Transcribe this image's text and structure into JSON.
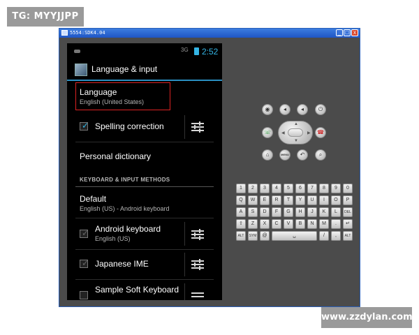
{
  "overlays": {
    "top_left_tag": "TG: MYYJJPP",
    "bottom_right_tag": "www.zzdylan.com"
  },
  "window": {
    "title": "5554:SDK4.04",
    "buttons": [
      "_",
      "□",
      "x"
    ]
  },
  "phone": {
    "status": {
      "signal": "3G",
      "time": "2:52"
    },
    "action_bar": {
      "title": "Language & input"
    },
    "items": {
      "language": {
        "title": "Language",
        "subtitle": "English (United States)"
      },
      "spelling": {
        "title": "Spelling correction",
        "checked": true
      },
      "dictionary": {
        "title": "Personal dictionary"
      },
      "section": "KEYBOARD & INPUT METHODS",
      "default": {
        "title": "Default",
        "subtitle": "English (US) - Android keyboard"
      },
      "android_kbd": {
        "title": "Android keyboard",
        "subtitle": "English (US)"
      },
      "japanese": {
        "title": "Japanese IME"
      },
      "sample": {
        "title": "Sample Soft Keyboard"
      }
    },
    "checkmark": "✓"
  },
  "controls": {
    "row1": [
      "camera-icon",
      "volume-down-icon",
      "volume-up-icon",
      "power-icon"
    ],
    "call": "☏",
    "endcall": "☎",
    "row3": {
      "home": "⌂",
      "menu": "MENU",
      "back": "↶",
      "search": "⌕"
    }
  },
  "keyboard": {
    "row1": [
      "1",
      "2",
      "3",
      "4",
      "5",
      "6",
      "7",
      "8",
      "9",
      "0"
    ],
    "row2": [
      "Q",
      "W",
      "E",
      "R",
      "T",
      "Y",
      "U",
      "I",
      "O",
      "P"
    ],
    "row3": [
      "A",
      "S",
      "D",
      "F",
      "G",
      "H",
      "J",
      "K",
      "L",
      "DEL"
    ],
    "row4": [
      "⇧",
      "Z",
      "X",
      "C",
      "V",
      "B",
      "N",
      "M",
      ".",
      "↵"
    ],
    "row5": {
      "alt1": "ALT",
      "sym": "SYM",
      "at": "@",
      "space": "␣",
      "slash": "/",
      "comma": ",",
      "alt2": "ALT"
    }
  }
}
